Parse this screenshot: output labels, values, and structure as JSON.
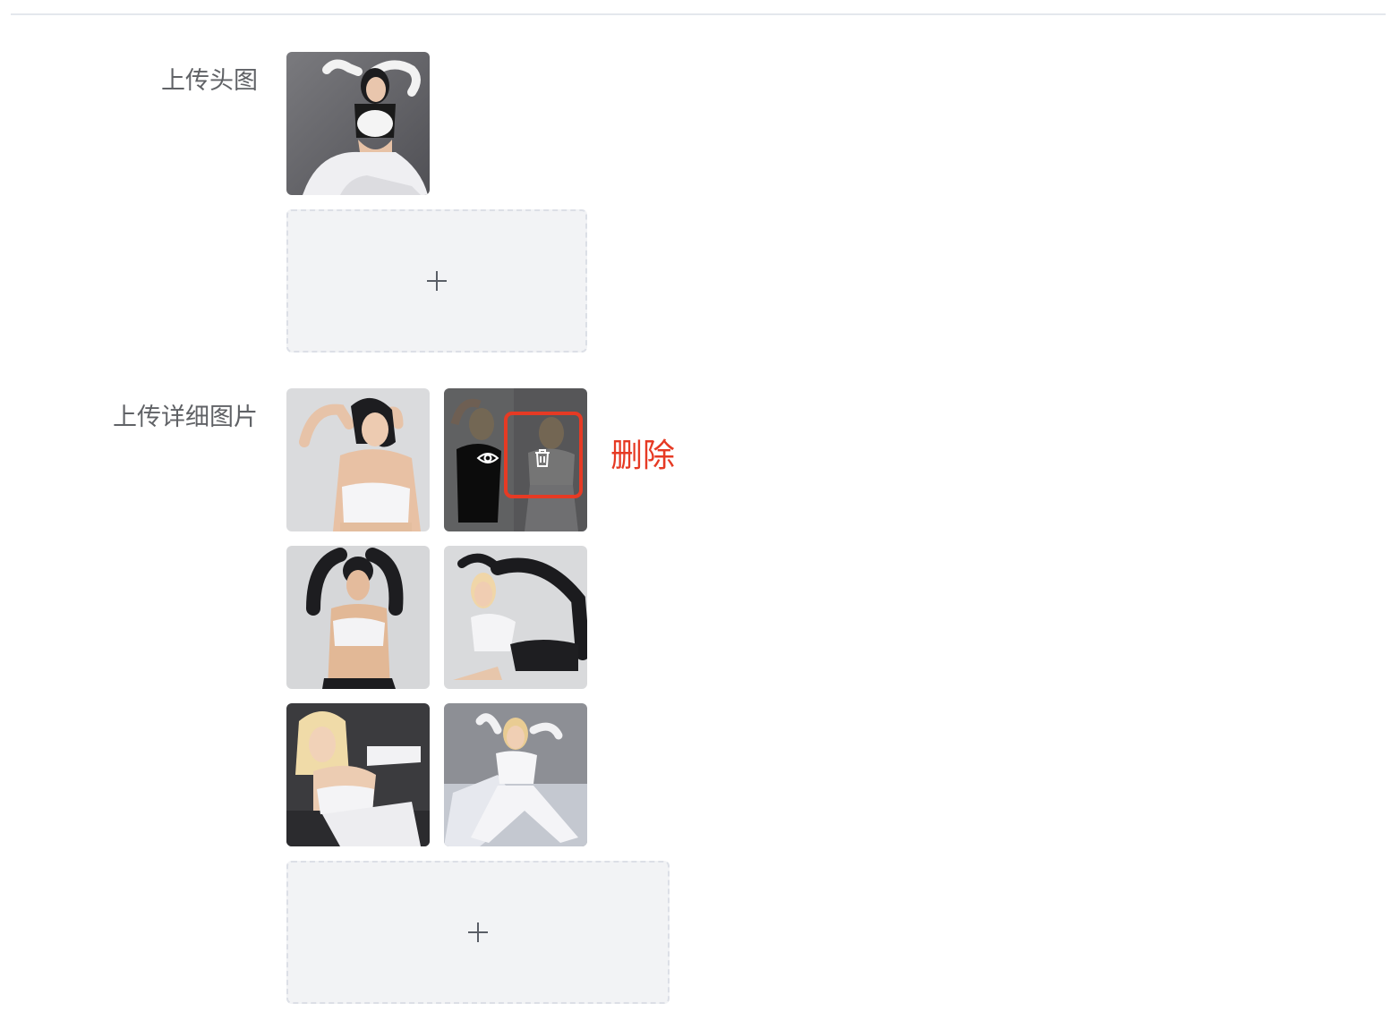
{
  "form": {
    "cover": {
      "label": "上传头图",
      "images": [
        {
          "alt": "cover-photo-1"
        }
      ],
      "upload_icon": "plus-icon"
    },
    "details": {
      "label": "上传详细图片",
      "images": [
        {
          "alt": "detail-photo-1"
        },
        {
          "alt": "detail-photo-2"
        },
        {
          "alt": "detail-photo-3"
        },
        {
          "alt": "detail-photo-4"
        },
        {
          "alt": "detail-photo-5"
        },
        {
          "alt": "detail-photo-6"
        }
      ],
      "upload_icon": "plus-icon",
      "hover_actions": {
        "preview_icon": "eye-icon",
        "delete_icon": "trash-icon"
      }
    }
  },
  "annotation": {
    "text": "删除",
    "color": "#e63a24"
  },
  "colors": {
    "label": "#606266",
    "upload_bg": "#f2f3f5",
    "upload_border": "#dcdfe6",
    "divider": "#e4e7ed",
    "highlight": "#e63a24"
  }
}
